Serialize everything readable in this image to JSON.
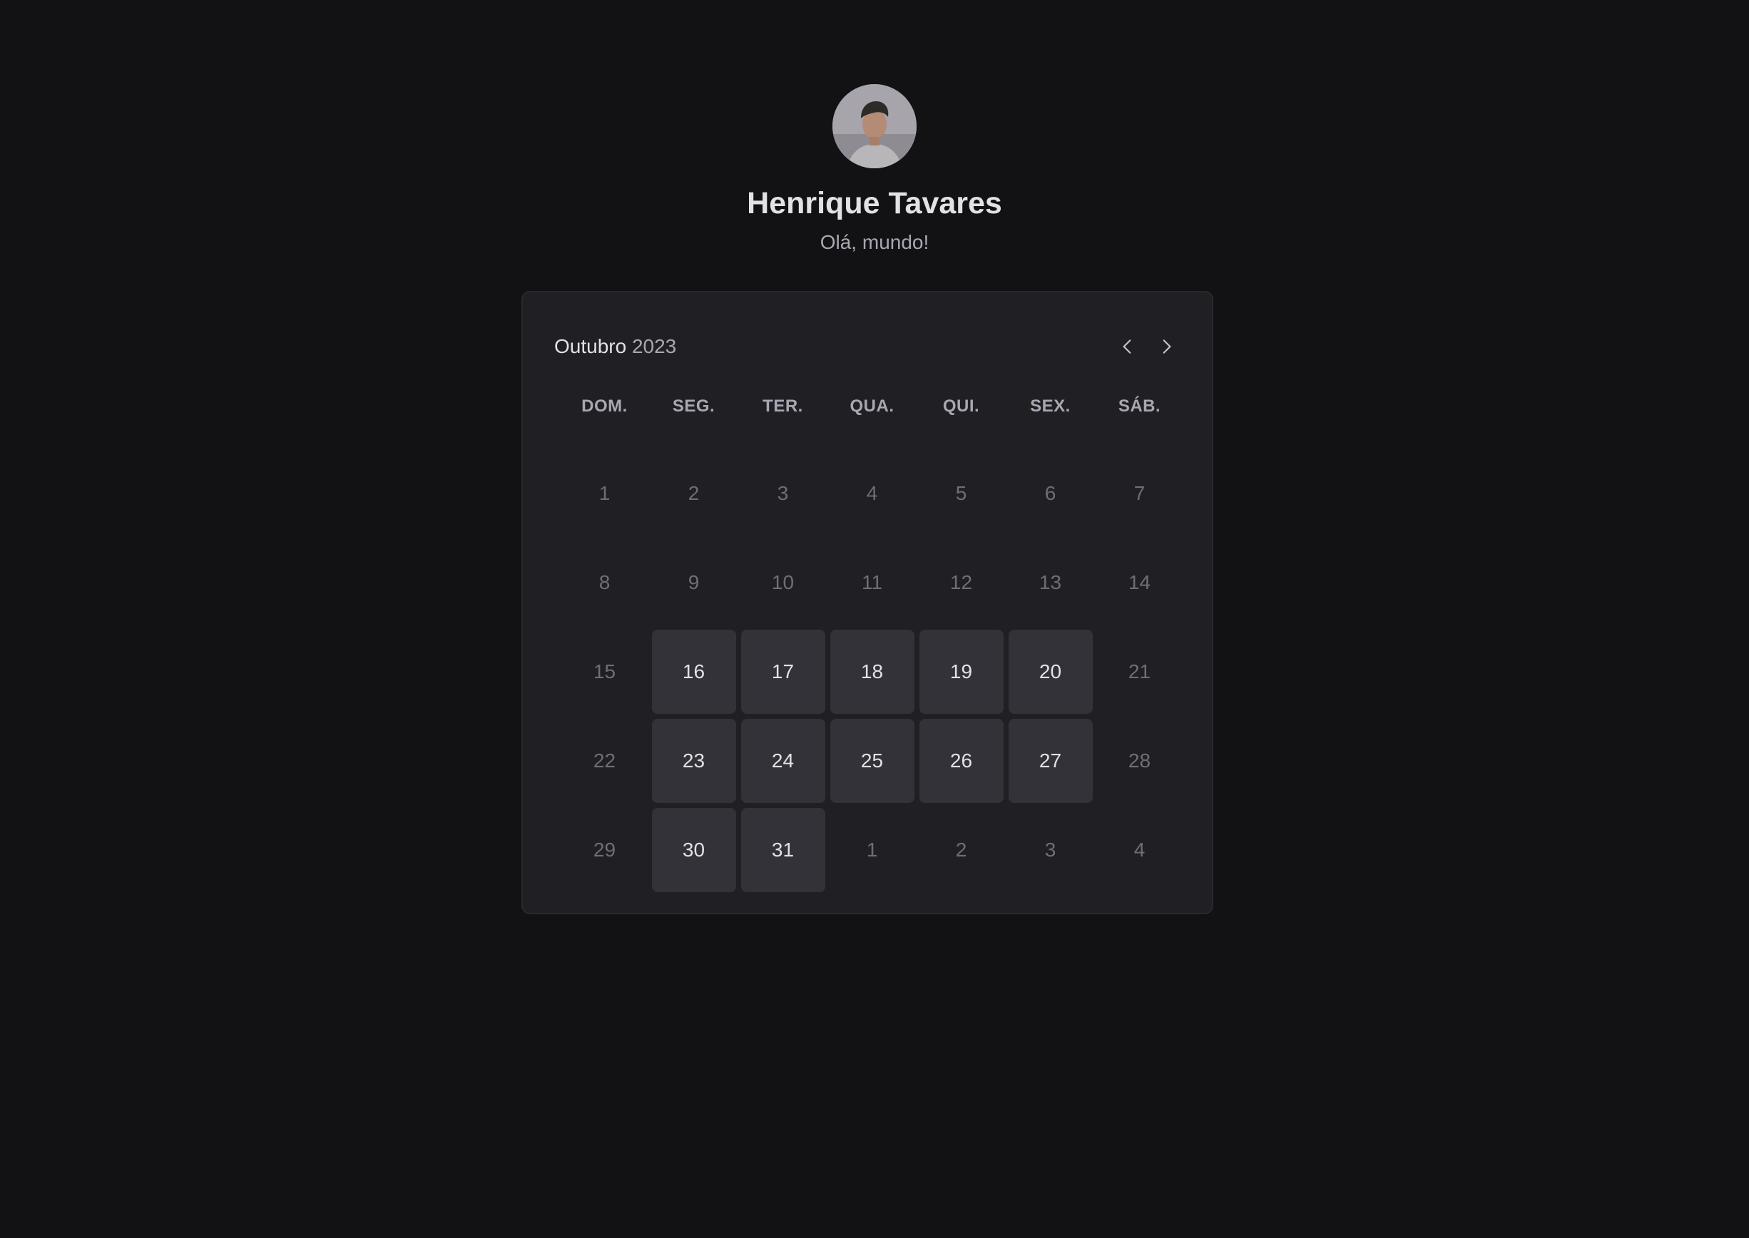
{
  "profile": {
    "name": "Henrique Tavares",
    "bio": "Olá, mundo!"
  },
  "calendar": {
    "month": "Outubro",
    "year": "2023",
    "weekdays": [
      "DOM.",
      "SEG.",
      "TER.",
      "QUA.",
      "QUI.",
      "SEX.",
      "SÁB."
    ],
    "days": [
      {
        "label": "1",
        "available": false
      },
      {
        "label": "2",
        "available": false
      },
      {
        "label": "3",
        "available": false
      },
      {
        "label": "4",
        "available": false
      },
      {
        "label": "5",
        "available": false
      },
      {
        "label": "6",
        "available": false
      },
      {
        "label": "7",
        "available": false
      },
      {
        "label": "8",
        "available": false
      },
      {
        "label": "9",
        "available": false
      },
      {
        "label": "10",
        "available": false
      },
      {
        "label": "11",
        "available": false
      },
      {
        "label": "12",
        "available": false
      },
      {
        "label": "13",
        "available": false
      },
      {
        "label": "14",
        "available": false
      },
      {
        "label": "15",
        "available": false
      },
      {
        "label": "16",
        "available": true
      },
      {
        "label": "17",
        "available": true
      },
      {
        "label": "18",
        "available": true
      },
      {
        "label": "19",
        "available": true
      },
      {
        "label": "20",
        "available": true
      },
      {
        "label": "21",
        "available": false
      },
      {
        "label": "22",
        "available": false
      },
      {
        "label": "23",
        "available": true
      },
      {
        "label": "24",
        "available": true
      },
      {
        "label": "25",
        "available": true
      },
      {
        "label": "26",
        "available": true
      },
      {
        "label": "27",
        "available": true
      },
      {
        "label": "28",
        "available": false
      },
      {
        "label": "29",
        "available": false
      },
      {
        "label": "30",
        "available": true
      },
      {
        "label": "31",
        "available": true
      },
      {
        "label": "1",
        "available": false
      },
      {
        "label": "2",
        "available": false
      },
      {
        "label": "3",
        "available": false
      },
      {
        "label": "4",
        "available": false
      }
    ],
    "prev_icon": "chevron-left-icon",
    "next_icon": "chevron-right-icon"
  },
  "colors": {
    "background": "#121214",
    "card": "#202024",
    "available_day": "#323238",
    "text_primary": "#e1e1e6",
    "text_muted": "#6e6e77"
  }
}
